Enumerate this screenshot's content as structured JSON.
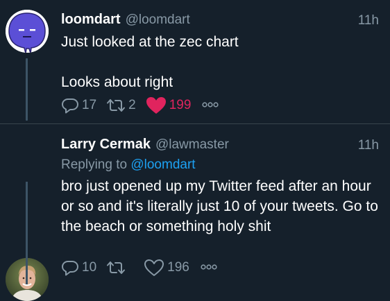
{
  "tweets": [
    {
      "display_name": "loomdart",
      "handle": "@loomdart",
      "time": "11h",
      "text": "Just looked at the zec chart\n\nLooks about right",
      "replies": "17",
      "retweets": "2",
      "likes": "199",
      "liked": true,
      "avatar": "purple-blob-face"
    },
    {
      "display_name": "Larry Cermak",
      "handle": "@lawmaster",
      "time": "11h",
      "replying_prefix": "Replying to",
      "replying_to": "@loomdart",
      "text": "bro just opened up my Twitter feed after an hour or so and it's literally just 10 of your tweets. Go to the beach or something holy shit",
      "replies": "10",
      "retweets": "",
      "likes": "196",
      "liked": false,
      "avatar": "man-photo"
    }
  ],
  "icons": {
    "reply": "reply-icon",
    "retweet": "retweet-icon",
    "like": "heart-icon",
    "more": "more-dots-icon"
  },
  "colors": {
    "background": "#15202b",
    "secondary_text": "#8899a6",
    "link": "#1da1f2",
    "liked": "#e0245e",
    "avatar_purple": "#5b4fd6"
  }
}
